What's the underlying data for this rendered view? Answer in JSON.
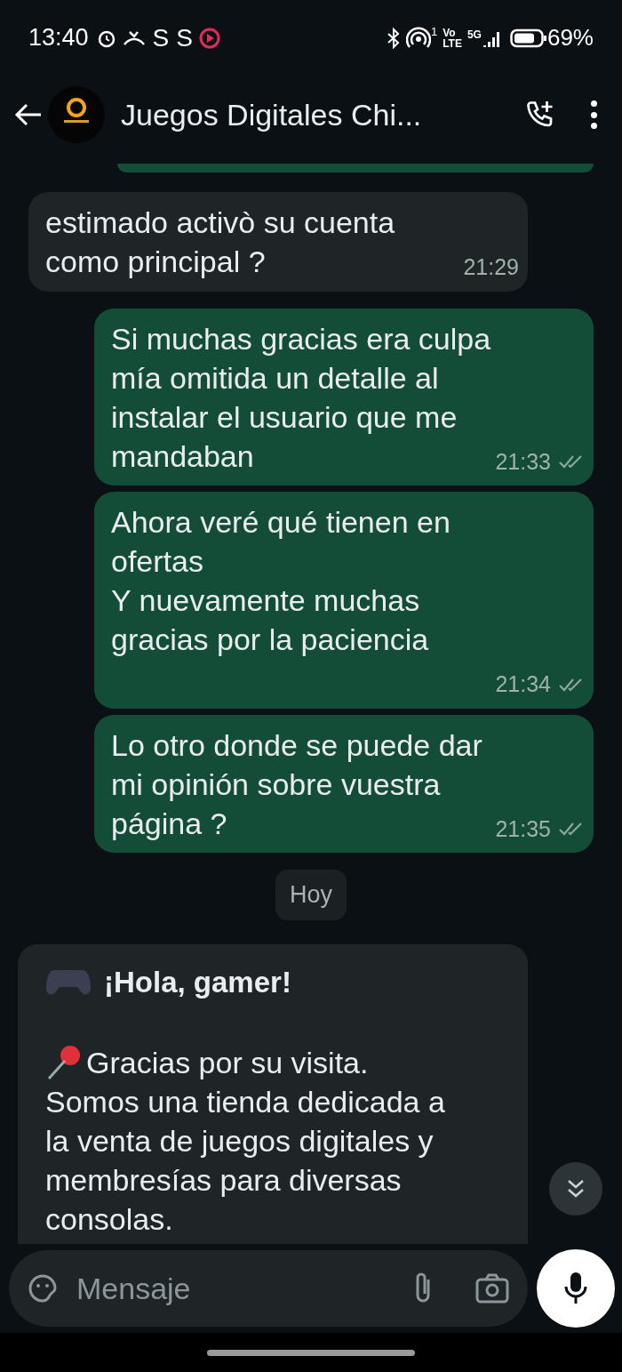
{
  "status_bar": {
    "time": "13:40",
    "notification_letters": [
      "S",
      "S"
    ],
    "network_top": "Vo",
    "network_bottom": "LTE",
    "sim": "1",
    "generation": "5G",
    "battery": "69%"
  },
  "header": {
    "title": "Juegos Digitales Chi..."
  },
  "messages": [
    {
      "kind": "incoming",
      "text": "estimado activò su cuenta como principal ?",
      "time": "21:29"
    },
    {
      "kind": "outgoing",
      "text": "Si muchas gracias era culpa mía omitida un detalle al instalar el usuario que me mandaban",
      "time": "21:33",
      "read": false
    },
    {
      "kind": "outgoing",
      "text": "Ahora veré qué tienen en ofertas\nY nuevamente muchas gracias por la paciencia",
      "time": "21:34",
      "read": false
    },
    {
      "kind": "outgoing",
      "text": "Lo otro donde se puede dar mi opinión sobre vuestra página ?",
      "time": "21:35",
      "read": false
    },
    {
      "kind": "date",
      "text": "Hoy"
    },
    {
      "kind": "card",
      "title": "¡Hola, gamer!",
      "lines": [
        "Gracias por su visita.",
        "Somos una tienda dedicada a la venta de juegos digitales y membresías para diversas consolas."
      ]
    }
  ],
  "composer": {
    "placeholder": "Mensaje"
  }
}
